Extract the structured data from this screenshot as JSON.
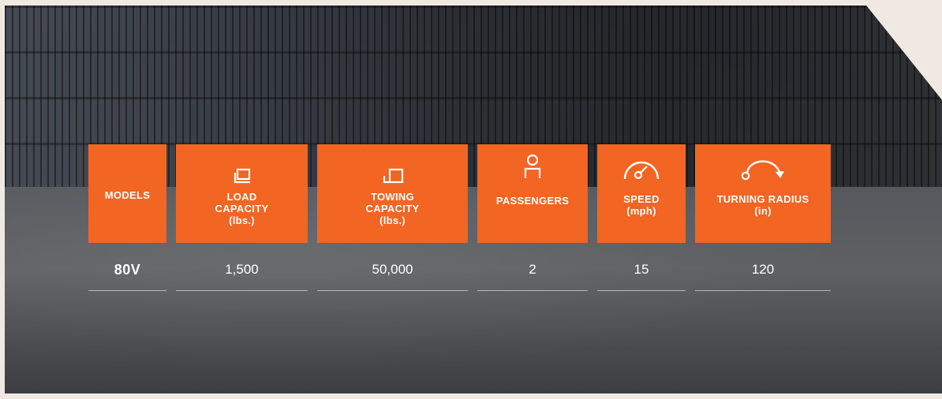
{
  "table": {
    "columns": [
      {
        "icon": "",
        "label": "MODELS",
        "unit": "",
        "value": "80V"
      },
      {
        "icon": "load-capacity-icon",
        "label": "LOAD CAPACITY",
        "unit": "(lbs.)",
        "value": "1,500"
      },
      {
        "icon": "towing-capacity-icon",
        "label": "TOWING CAPACITY",
        "unit": "(lbs.)",
        "value": "50,000"
      },
      {
        "icon": "passenger-icon",
        "label": "PASSENGERS",
        "unit": "",
        "value": "2"
      },
      {
        "icon": "speedometer-icon",
        "label": "SPEED",
        "unit": "(mph)",
        "value": "15"
      },
      {
        "icon": "turning-radius-icon",
        "label": "TURNING RADIUS",
        "unit": "(in)",
        "value": "120"
      }
    ]
  },
  "colors": {
    "accent": "#f26522",
    "text": "#ffffff",
    "page_background": "#efe9e2"
  }
}
